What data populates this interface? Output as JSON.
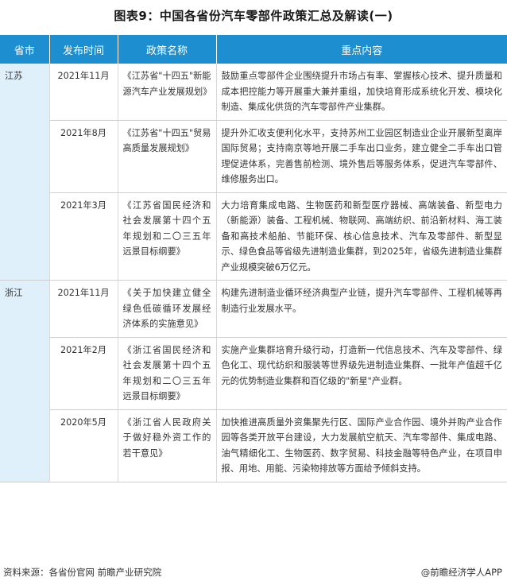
{
  "title": "图表9：中国各省份汽车零部件政策汇总及解读(一)",
  "headers": [
    "省市",
    "发布时间",
    "政策名称",
    "重点内容"
  ],
  "rows": [
    {
      "province": "江苏",
      "date": "2021年11月",
      "name": "《江苏省\"十四五\"新能源汽车产业发展规划》",
      "content": "鼓励重点零部件企业围绕提升市场占有率、掌握核心技术、提升质量和成本把控能力等开展重大兼并重组，加快培育形成系统化开发、模块化制造、集成化供货的汽车零部件产业集群。"
    },
    {
      "province": "",
      "date": "2021年8月",
      "name": "《江苏省\"十四五\"贸易高质量发展规划》",
      "content": "提升外汇收支便利化水平，支持苏州工业园区制造业企业开展新型离岸国际贸易；支持南京等地开展二手车出口业务，建立健全二手车出口管理促进体系，完善售前检测、境外售后等服务体系，促进汽车零部件、维修服务出口。"
    },
    {
      "province": "",
      "date": "2021年3月",
      "name": "《江苏省国民经济和社会发展第十四个五年规划和二〇三五年远景目标纲要》",
      "content": "大力培育集成电路、生物医药和新型医疗器械、高端装备、新型电力（新能源）装备、工程机械、物联网、高端纺织、前沿新材料、海工装备和高技术船舶、节能环保、核心信息技术、汽车及零部件、新型显示、绿色食品等省级先进制造业集群，到2025年，省级先进制造业集群产业规模突破6万亿元。"
    },
    {
      "province": "浙江",
      "date": "2021年11月",
      "name": "《关于加快建立健全绿色低碳循环发展经济体系的实施意见》",
      "content": "构建先进制造业循环经济典型产业链，提升汽车零部件、工程机械等再制造行业发展水平。"
    },
    {
      "province": "",
      "date": "2021年2月",
      "name": "《浙江省国民经济和社会发展第十四个五年规划和二〇三五年远景目标纲要》",
      "content": "实施产业集群培育升级行动，打造新一代信息技术、汽车及零部件、绿色化工、现代纺织和服装等世界级先进制造业集群、一批年产值超千亿元的优势制造业集群和百亿级的\"新星\"产业群。"
    },
    {
      "province": "",
      "date": "2020年5月",
      "name": "《浙江省人民政府关于做好稳外资工作的若干意见》",
      "content": "加快推进高质量外资集聚先行区、国际产业合作园、境外并购产业合作园等各类开放平台建设，大力发展航空航天、汽车零部件、集成电路、油气精细化工、生物医药、数字贸易、科技金融等特色产业，在项目申报、用地、用能、污染物排放等方面给予倾斜支持。"
    }
  ],
  "source": "资料来源：各省份官网 前瞻产业研究院",
  "credit": "@前瞻经济学人APP"
}
